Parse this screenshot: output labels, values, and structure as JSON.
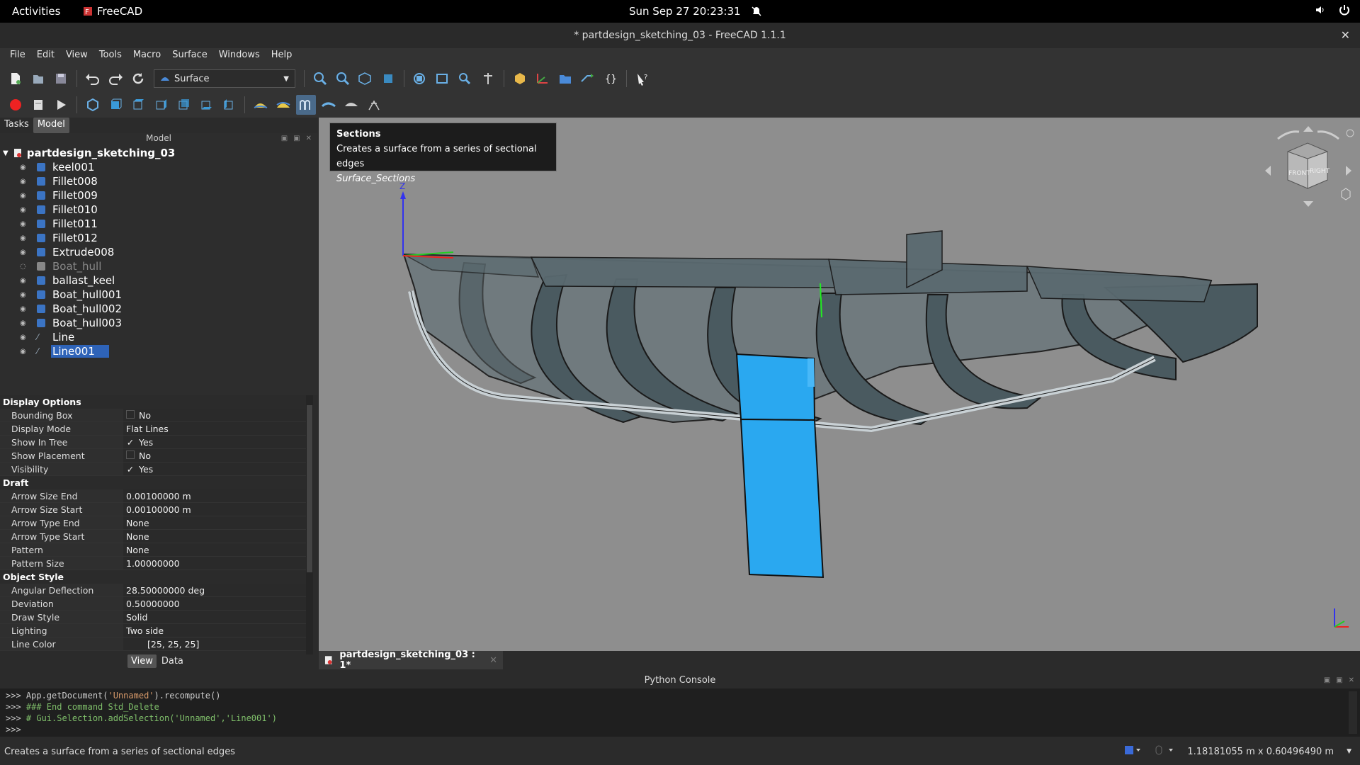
{
  "system_bar": {
    "activities": "Activities",
    "app_name": "FreeCAD",
    "clock": "Sun Sep 27  20:23:31"
  },
  "window": {
    "title": "* partdesign_sketching_03 - FreeCAD 1.1.1"
  },
  "menu": [
    "File",
    "Edit",
    "View",
    "Tools",
    "Macro",
    "Surface",
    "Windows",
    "Help"
  ],
  "workbench": {
    "selected": "Surface"
  },
  "left_tabs": {
    "tasks": "Tasks",
    "model": "Model"
  },
  "model_panel": {
    "header": "Model",
    "root": "partdesign_sketching_03",
    "items": [
      {
        "label": "keel001",
        "type": "body"
      },
      {
        "label": "Fillet008",
        "type": "body"
      },
      {
        "label": "Fillet009",
        "type": "body"
      },
      {
        "label": "Fillet010",
        "type": "body"
      },
      {
        "label": "Fillet011",
        "type": "body"
      },
      {
        "label": "Fillet012",
        "type": "body"
      },
      {
        "label": "Extrude008",
        "type": "body"
      },
      {
        "label": "Boat_hull",
        "type": "hidden"
      },
      {
        "label": "ballast_keel",
        "type": "body"
      },
      {
        "label": "Boat_hull001",
        "type": "body"
      },
      {
        "label": "Boat_hull002",
        "type": "body"
      },
      {
        "label": "Boat_hull003",
        "type": "body"
      },
      {
        "label": "Line",
        "type": "line"
      },
      {
        "label": "Line001",
        "type": "line-selected"
      }
    ]
  },
  "properties": {
    "groups": [
      {
        "name": "Display Options",
        "rows": [
          {
            "k": "Bounding Box",
            "v": "No",
            "check": ""
          },
          {
            "k": "Display Mode",
            "v": "Flat Lines"
          },
          {
            "k": "Show In Tree",
            "v": "Yes",
            "check": "✓"
          },
          {
            "k": "Show Placement",
            "v": "No",
            "check": ""
          },
          {
            "k": "Visibility",
            "v": "Yes",
            "check": "✓"
          }
        ]
      },
      {
        "name": "Draft",
        "rows": [
          {
            "k": "Arrow Size End",
            "v": "0.00100000 m"
          },
          {
            "k": "Arrow Size Start",
            "v": "0.00100000 m"
          },
          {
            "k": "Arrow Type End",
            "v": "None"
          },
          {
            "k": "Arrow Type Start",
            "v": "None"
          },
          {
            "k": "Pattern",
            "v": "None"
          },
          {
            "k": "Pattern Size",
            "v": "1.00000000"
          }
        ]
      },
      {
        "name": "Object Style",
        "rows": [
          {
            "k": "Angular Deflection",
            "v": "28.50000000 deg"
          },
          {
            "k": "Deviation",
            "v": "0.50000000"
          },
          {
            "k": "Draw Style",
            "v": "Solid"
          },
          {
            "k": "Lighting",
            "v": "Two side"
          },
          {
            "k": "Line Color",
            "v": "[25, 25, 25]"
          }
        ]
      }
    ],
    "tabs": {
      "view": "View",
      "data": "Data"
    }
  },
  "tooltip": {
    "title": "Sections",
    "desc": "Creates a surface from a series of sectional edges",
    "cmd": "Surface_Sections"
  },
  "viewport": {
    "axis_z": "Z",
    "cube_front": "FRONT",
    "cube_right": "RIGHT",
    "mini_axis": "z x"
  },
  "doc_tab": {
    "label": "partdesign_sketching_03 : 1*"
  },
  "console": {
    "header": "Python Console",
    "lines": [
      {
        "prefix": ">>> ",
        "pre": "App.getDocument(",
        "str": "'Unnamed'",
        "post": ").recompute()"
      },
      {
        "prefix": ">>> ",
        "cmt": "### End command Std_Delete"
      },
      {
        "prefix": ">>> ",
        "cmt": "# Gui.Selection.addSelection('Unnamed','Line001')"
      },
      {
        "prefix": ">>> "
      }
    ]
  },
  "status": {
    "message": "Creates a surface from a series of sectional edges",
    "dimensions": "1.18181055 m x 0.60496490 m"
  },
  "colors": {
    "viewport_bg": "#8e8e8e",
    "hull": "#4a5a60",
    "keel": "#2aa8f0",
    "selection": "#2e63b8"
  }
}
